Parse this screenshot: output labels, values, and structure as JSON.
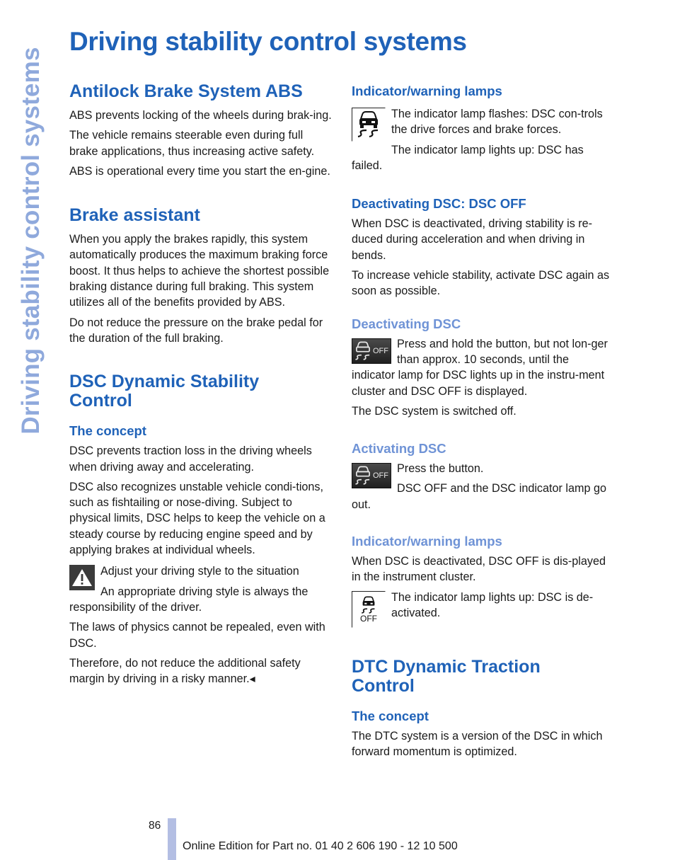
{
  "side_tab": "Driving stability control systems",
  "page_title": "Driving stability control systems",
  "left": {
    "abs": {
      "heading": "Antilock Brake System ABS",
      "paragraphs": [
        "ABS prevents locking of the wheels during brak-ing.",
        "The vehicle remains steerable even during full brake applications, thus increasing active safety.",
        "ABS is operational every time you start the en-gine."
      ]
    },
    "brake_assistant": {
      "heading": "Brake assistant",
      "paragraphs": [
        "When you apply the brakes rapidly, this system automatically produces the maximum braking force boost. It thus helps to achieve the shortest possible braking distance during full braking. This system utilizes all of the benefits provided by ABS.",
        "Do not reduce the pressure on the brake pedal for the duration of the full braking."
      ]
    },
    "dsc": {
      "heading": "DSC Dynamic Stability Control",
      "concept_heading": "The concept",
      "paragraphs": [
        "DSC prevents traction loss in the driving wheels when driving away and accelerating.",
        "DSC also recognizes unstable vehicle condi-tions, such as fishtailing or nose-diving. Subject to physical limits, DSC helps to keep the vehicle on a steady course by reducing engine speed and by applying brakes at individual wheels."
      ],
      "warning": {
        "icon": "warning-triangle-icon",
        "title": "Adjust your driving style to the situation",
        "paragraphs": [
          "An appropriate driving style is always the responsibility of the driver.",
          "The laws of physics cannot be repealed, even with DSC.",
          "Therefore, do not reduce the additional safety margin by driving in a risky manner.◂"
        ]
      }
    }
  },
  "right": {
    "indicator1": {
      "heading": "Indicator/warning lamps",
      "icon": "dsc-lamp-icon",
      "paragraphs": [
        "The indicator lamp flashes: DSC con-trols the drive forces and brake forces.",
        "The indicator lamp lights up: DSC has failed."
      ]
    },
    "deactivating_off": {
      "heading": "Deactivating DSC: DSC OFF",
      "paragraphs": [
        "When DSC is deactivated, driving stability is re-duced during acceleration and when driving in bends.",
        "To increase vehicle stability, activate DSC again as soon as possible."
      ]
    },
    "deactivating": {
      "heading": "Deactivating DSC",
      "button_label": "OFF",
      "paragraphs": [
        "Press and hold the button, but not lon-ger than approx. 10 seconds, until the indicator lamp for DSC lights up in the instru-ment cluster and DSC OFF is displayed.",
        "The DSC system is switched off."
      ]
    },
    "activating": {
      "heading": "Activating DSC",
      "button_label": "OFF",
      "paragraphs": [
        "Press the button.",
        "DSC OFF and the DSC indicator lamp go out."
      ]
    },
    "indicator2": {
      "heading": "Indicator/warning lamps",
      "icon_label": "OFF",
      "paragraphs": [
        "When DSC is deactivated, DSC OFF is dis-played in the instrument cluster.",
        "The indicator lamp lights up: DSC is de-activated."
      ]
    },
    "dtc": {
      "heading": "DTC Dynamic Traction Control",
      "concept_heading": "The concept",
      "paragraphs": [
        "The DTC system is a version of the DSC in which forward momentum is optimized."
      ]
    }
  },
  "footer": {
    "page_number": "86",
    "edition": "Online Edition for Part no. 01 40 2 606 190 - 12 10 500"
  },
  "colors": {
    "heading_blue": "#1f62b8",
    "subheading_light_blue": "#6f93d6",
    "side_tab": "#8fa9dc",
    "footer_bar": "#b3bee3"
  }
}
